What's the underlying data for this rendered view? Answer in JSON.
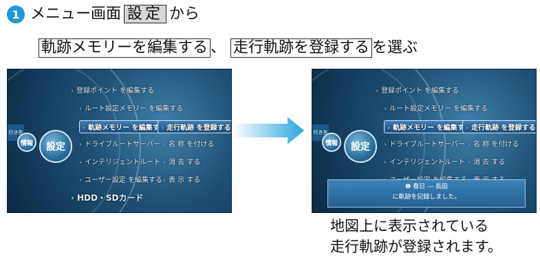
{
  "instructions": {
    "step_number": "1",
    "line1_before": "メニュー画面",
    "settings_key": "設定",
    "line1_after": "から",
    "option1": "軌跡メモリーを編集する",
    "separator": "、",
    "option2": "走行軌跡を登録する",
    "line2_after": "を選ぶ"
  },
  "menu_screen": {
    "side_tab": "行き先",
    "info_button": "情報",
    "settings_button": "設定",
    "items": {
      "register_point": "登録ポイント を編集する",
      "route_settings": "ルート設定メモリー を編集する",
      "track_memory": "軌跡メモリー を編集する",
      "drive_track": "走行軌跡 を登録する",
      "drive_root": "ドライブルートサーバー",
      "name": "名 称 を付ける",
      "intelligent_route": "インテリジェントルート",
      "erase": "消 去 する",
      "user_settings": "ユーザー設定 を編集する",
      "display": "表 示 する",
      "hdd_sd": "HDD・SDカード"
    },
    "notice": {
      "line1": "❶ 春日 ― 長田",
      "line2": "に軌跡を記録しました。"
    }
  },
  "caption": {
    "line1": "地図上に表示されている",
    "line2": "走行軌跡が登録されます。"
  },
  "colors": {
    "accent": "#1f9ad6",
    "screen_bg": "#1d4f74"
  }
}
